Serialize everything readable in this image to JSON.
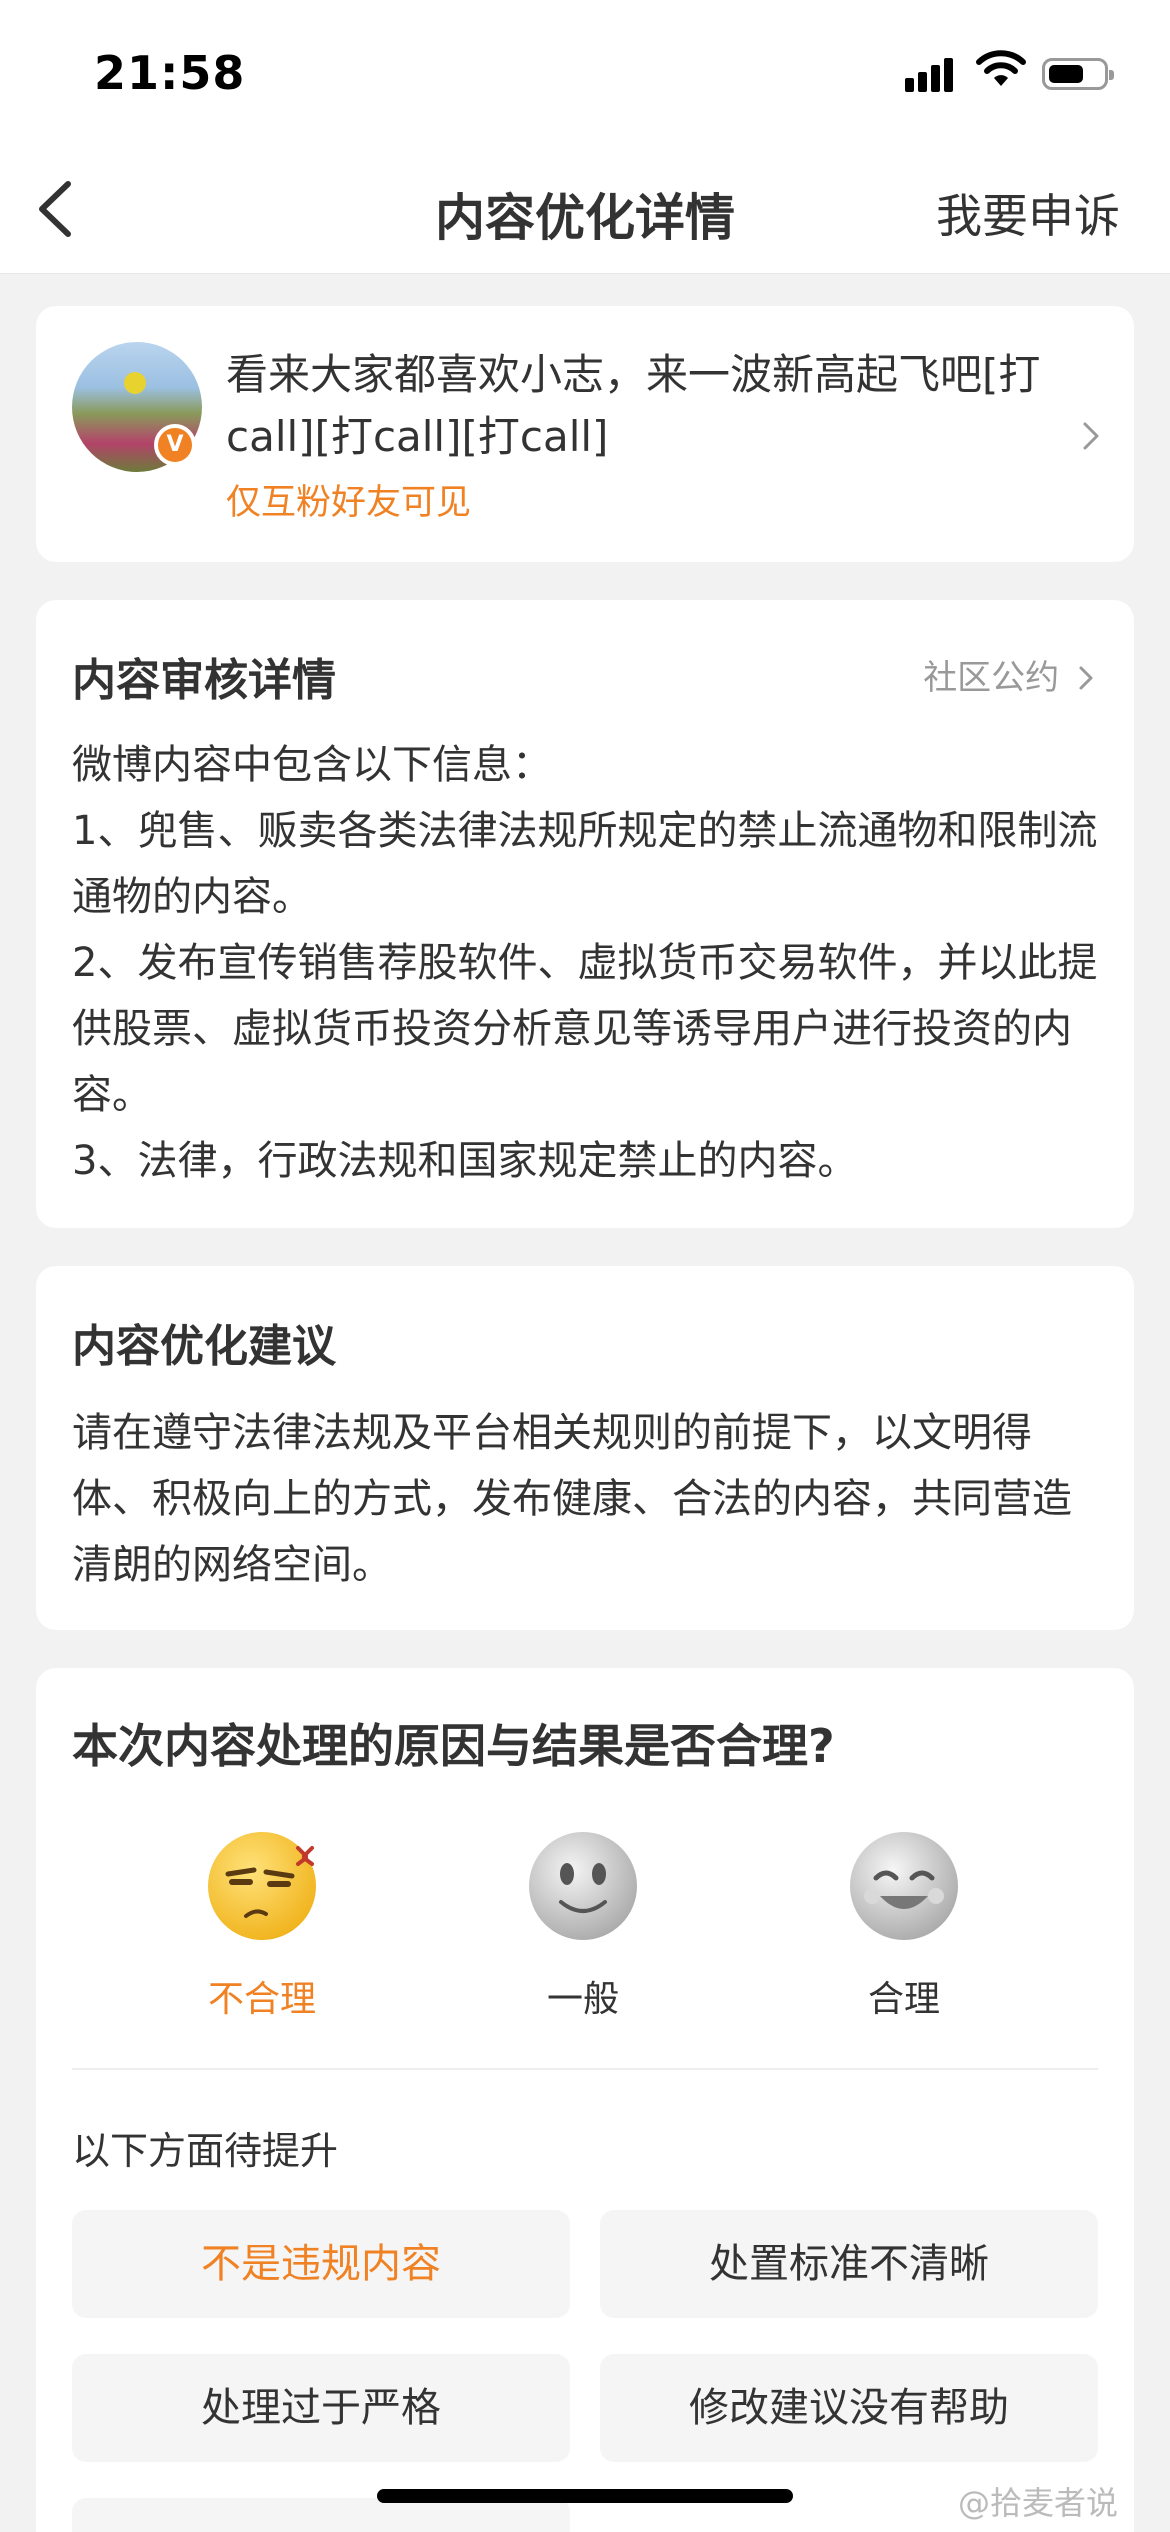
{
  "status_bar": {
    "time": "21:58"
  },
  "nav": {
    "title": "内容优化详情",
    "appeal_label": "我要申诉",
    "back_icon": "chevron-left-icon"
  },
  "post": {
    "avatar_badge": "V",
    "text": "看来大家都喜欢小志，来一波新高起飞吧[打call][打call][打call]",
    "visibility": "仅互粉好友可见",
    "accent_color": "#f08224"
  },
  "review": {
    "title": "内容审核详情",
    "rules_link": "社区公约",
    "lines": [
      "微博内容中包含以下信息：",
      "1、兜售、贩卖各类法律法规所规定的禁止流通物和限制流通物的内容。",
      "2、发布宣传销售荐股软件、虚拟货币交易软件，并以此提供股票、虚拟货币投资分析意见等诱导用户进行投资的内容。",
      "3、法律，行政法规和国家规定禁止的内容。"
    ]
  },
  "suggestion": {
    "title": "内容优化建议",
    "text": "请在遵守法律法规及平台相关规则的前提下，以文明得体、积极向上的方式，发布健康、合法的内容，共同营造清朗的网络空间。"
  },
  "feedback": {
    "question": "本次内容处理的原因与结果是否合理?",
    "ratings": [
      {
        "label": "不合理",
        "icon": "annoyed-face-icon",
        "selected": true
      },
      {
        "label": "一般",
        "icon": "neutral-face-icon",
        "selected": false
      },
      {
        "label": "合理",
        "icon": "smile-face-icon",
        "selected": false
      }
    ],
    "improve_title": "以下方面待提升",
    "options": [
      {
        "label": "不是违规内容",
        "selected": true
      },
      {
        "label": "处置标准不清晰",
        "selected": false
      },
      {
        "label": "处理过于严格",
        "selected": false
      },
      {
        "label": "修改建议没有帮助",
        "selected": false
      }
    ]
  },
  "watermark": "@拾麦者说"
}
